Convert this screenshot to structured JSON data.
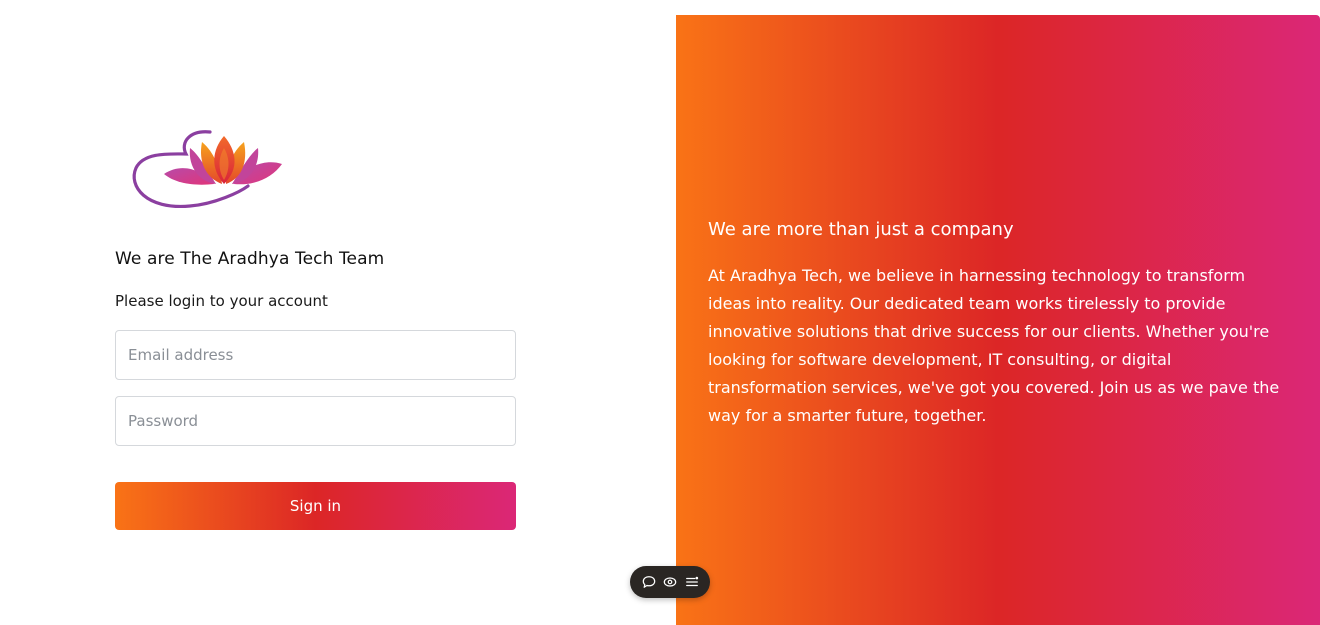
{
  "login": {
    "heading": "We are The Aradhya Tech Team",
    "subheading": "Please login to your account",
    "email_placeholder": "Email address",
    "password_placeholder": "Password",
    "signin_label": "Sign in"
  },
  "promo": {
    "headline": "We are more than just a company",
    "body": "At Aradhya Tech, we believe in harnessing technology to transform ideas into reality. Our dedicated team works tirelessly to provide innovative solutions that drive success for our clients. Whether you're looking for software development, IT consulting, or digital transformation services, we've got you covered. Join us as we pave the way for a smarter future, together."
  },
  "colors": {
    "gradient_start": "#f97316",
    "gradient_mid": "#dc2626",
    "gradient_end": "#db2777",
    "logo_purple": "#8b3fa0"
  },
  "toolbar": {
    "icons": [
      "comment-icon",
      "eye-icon",
      "menu-icon"
    ]
  }
}
